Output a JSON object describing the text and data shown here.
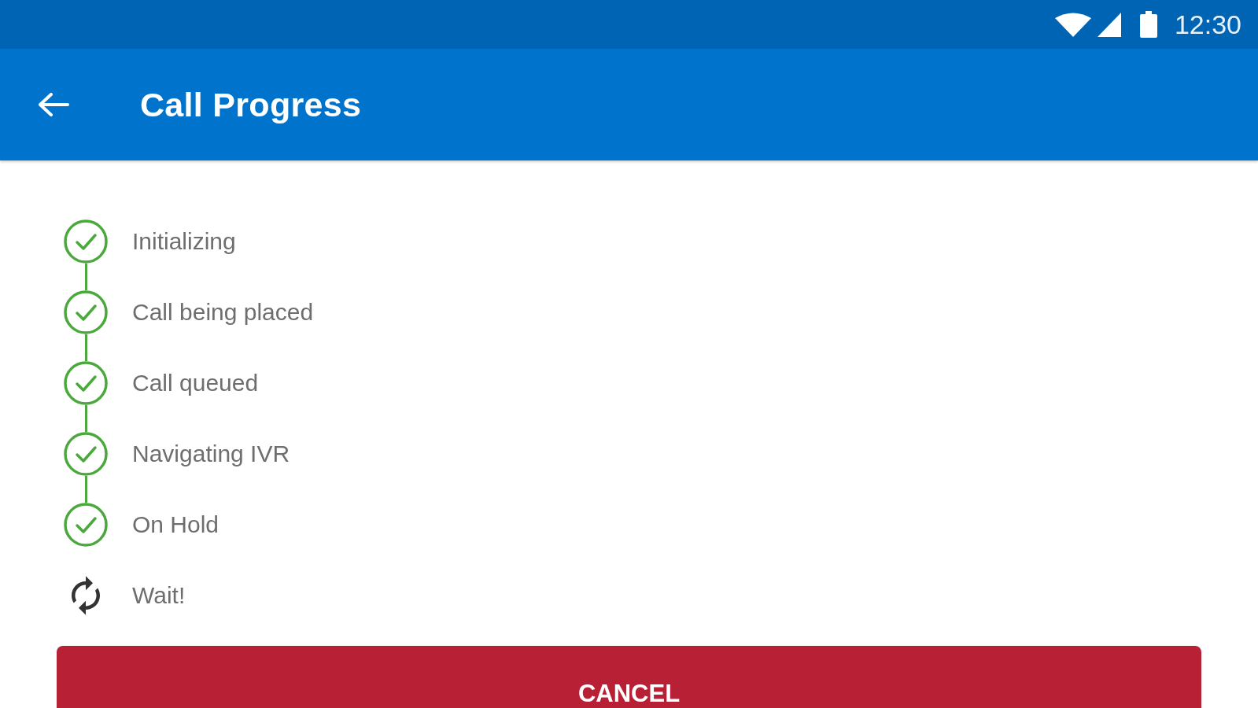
{
  "status_bar": {
    "time": "12:30"
  },
  "app_bar": {
    "title": "Call Progress"
  },
  "steps": [
    {
      "label": "Initializing",
      "done": true
    },
    {
      "label": "Call being placed",
      "done": true
    },
    {
      "label": "Call queued",
      "done": true
    },
    {
      "label": "Navigating IVR",
      "done": true
    },
    {
      "label": "On Hold",
      "done": true
    },
    {
      "label": "Wait!",
      "done": false
    }
  ],
  "cancel_button": {
    "label": "CANCEL"
  }
}
